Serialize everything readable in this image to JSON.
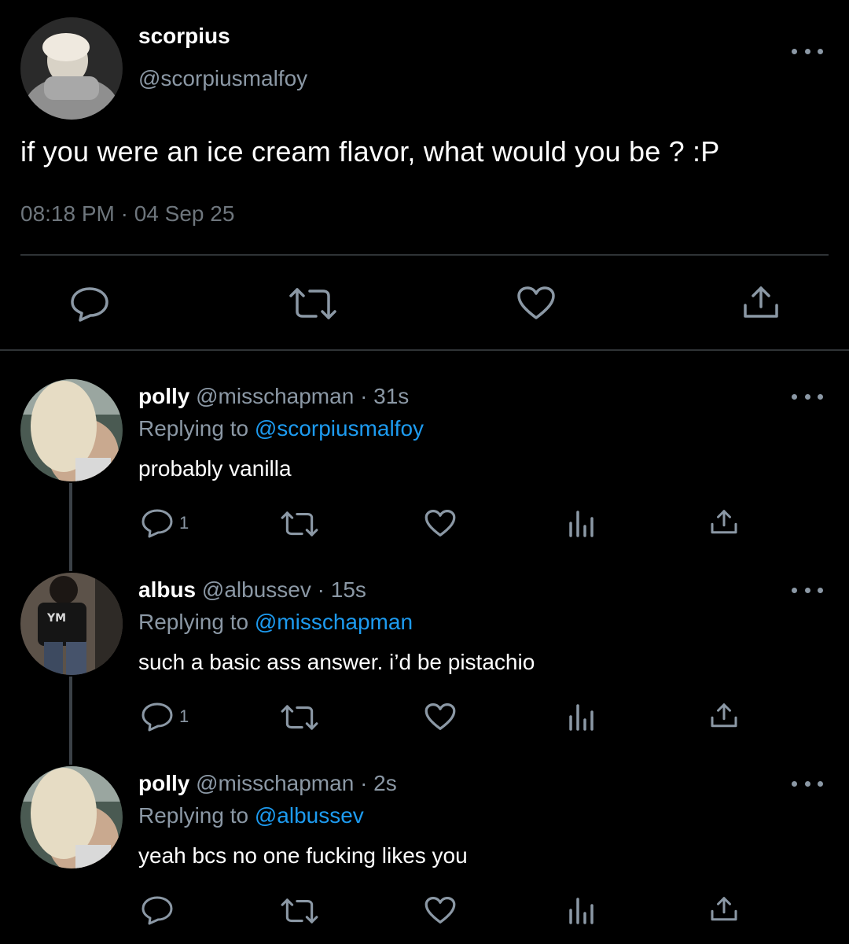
{
  "tweet": {
    "author_name": "scorpius",
    "author_handle": "@scorpiusmalfoy",
    "text": "if you were an ice cream flavor, what would you be ? :P",
    "timestamp": "08:18 PM · 04 Sep 25",
    "actions": [
      "reply-icon",
      "retweet-icon",
      "like-icon",
      "share-icon"
    ],
    "more_icon": "more-icon"
  },
  "replies": [
    {
      "name": "polly",
      "handle": "@misschapman",
      "time": "· 31s",
      "replying_label": "Replying to",
      "replying_to": "@scorpiusmalfoy",
      "text": "probably vanilla",
      "reply_count": "1"
    },
    {
      "name": "albus",
      "handle": "@albussev",
      "time": "· 15s",
      "replying_label": "Replying to",
      "replying_to": "@misschapman",
      "text": "such a basic ass answer. i’d be pistachio",
      "reply_count": "1"
    },
    {
      "name": "polly",
      "handle": "@misschapman",
      "time": "· 2s",
      "replying_label": "Replying to",
      "replying_to": "@albussev",
      "text": "yeah bcs no one fucking likes you",
      "reply_count": ""
    }
  ],
  "colors": {
    "background": "#000000",
    "text": "#ffffff",
    "muted": "#8b98a5",
    "link": "#1d9bf0",
    "divider": "#2f3336"
  }
}
